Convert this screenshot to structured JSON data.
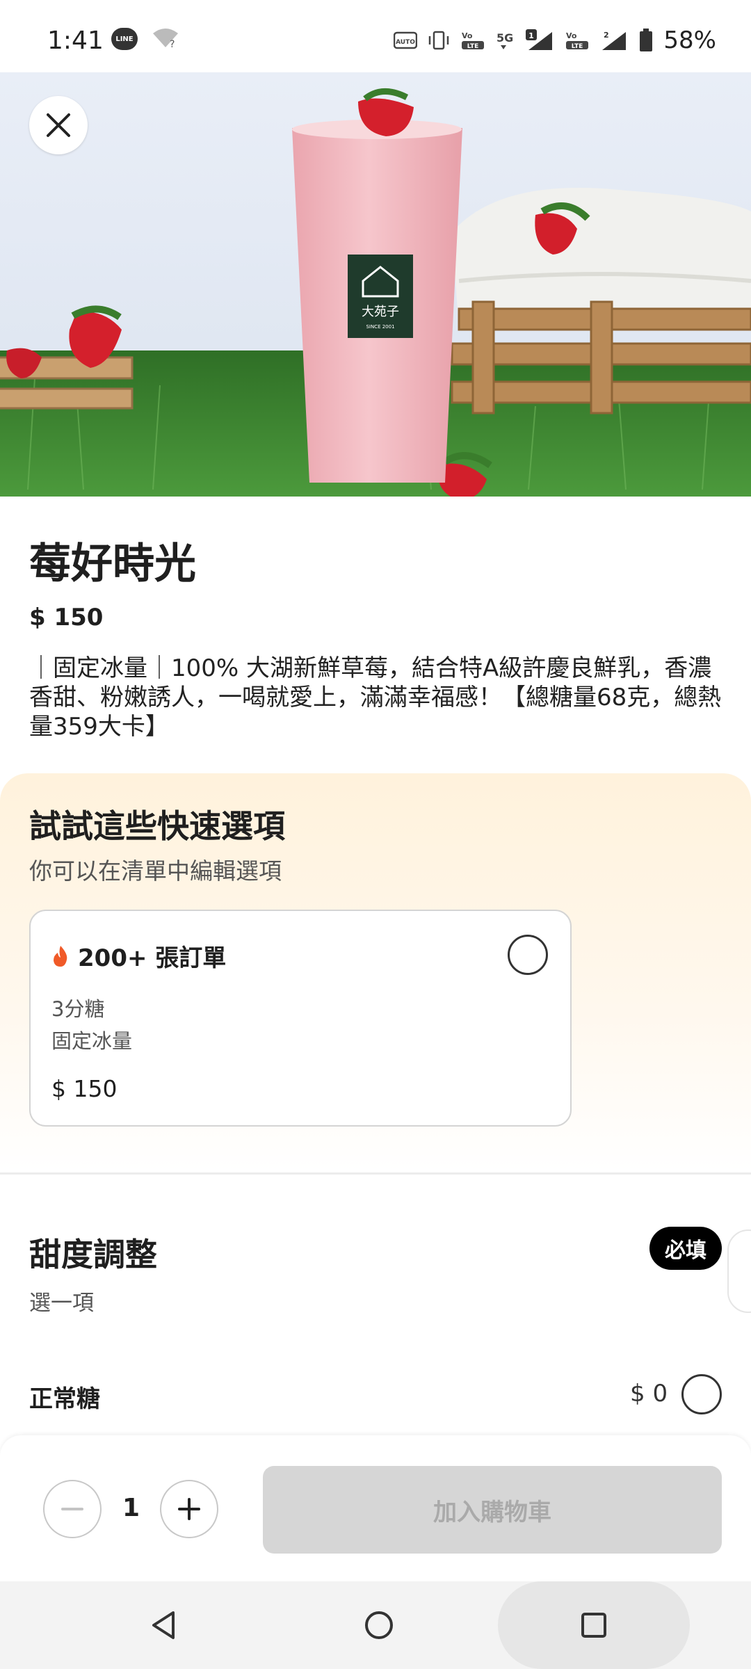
{
  "status_bar": {
    "time": "1:41",
    "line_icon_text": "LINE",
    "battery_percent": "58%",
    "network": "5G",
    "sim1_badge": "1",
    "sim2_badge": "2",
    "auto_label": "AUTO",
    "volte_label": "LTE"
  },
  "product": {
    "title": "莓好時光",
    "price": "$ 150",
    "description": "｜固定冰量｜100% 大湖新鮮草莓，結合特A級許慶良鮮乳，香濃香甜、粉嫩誘人，一喝就愛上，滿滿幸福感！【總糖量68克，總熱量359大卡】",
    "cup_logo_text": "大苑子",
    "cup_logo_since": "SINCE 2001"
  },
  "quick_options": {
    "title": "試試這些快速選項",
    "subtitle": "你可以在清單中編輯選項",
    "card": {
      "orders_label": "200+ 張訂單",
      "options": [
        "3分糖",
        "固定冰量"
      ],
      "price": "$ 150"
    }
  },
  "sweetness": {
    "title": "甜度調整",
    "subtitle": "選一項",
    "required_badge": "必填",
    "options": [
      {
        "label": "正常糖",
        "price": "$ 0"
      }
    ]
  },
  "action_bar": {
    "quantity": "1",
    "add_to_cart_label": "加入購物車"
  },
  "colors": {
    "quick_section_bg": "#fff2dc",
    "flame": "#f05a28",
    "add_cart_disabled": "#d6d6d6",
    "drink_pink": "#f2b6be",
    "grass": "#3f8a34"
  }
}
